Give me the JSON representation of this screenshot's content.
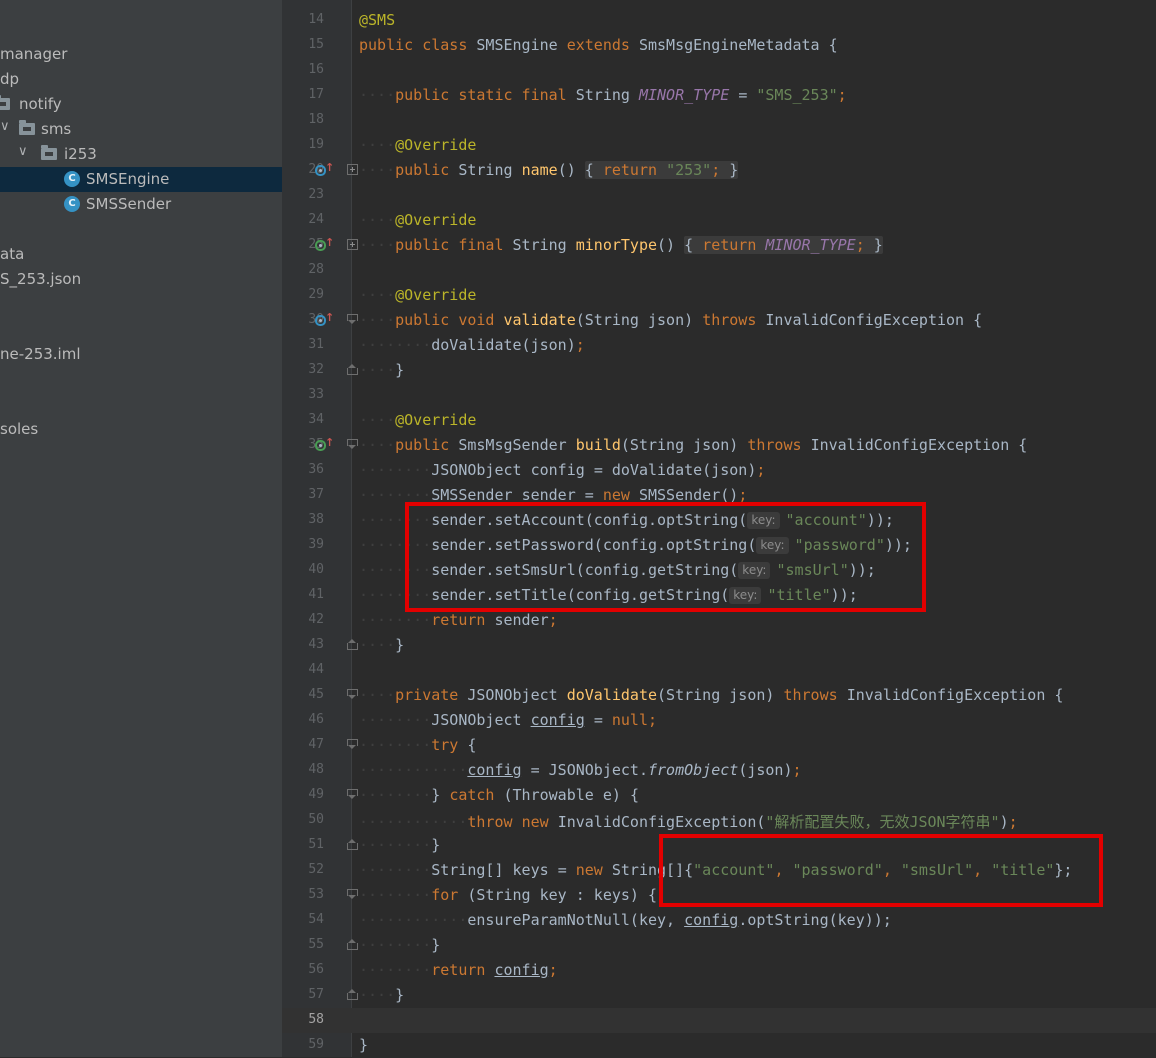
{
  "sidebar": {
    "items": [
      {
        "label": "manager"
      },
      {
        "label": "dp"
      },
      {
        "label": "notify"
      },
      {
        "label": "sms"
      },
      {
        "label": "i253"
      },
      {
        "label": "SMSEngine"
      },
      {
        "label": "SMSSender"
      },
      {
        "label": "ata"
      },
      {
        "label": "S_253.json"
      },
      {
        "label": "ne-253.iml"
      },
      {
        "label": "soles"
      }
    ],
    "class_icon_glyph": "C"
  },
  "editor": {
    "line_numbers": [
      "14",
      "15",
      "16",
      "17",
      "18",
      "19",
      "20",
      "23",
      "24",
      "25",
      "28",
      "29",
      "30",
      "31",
      "32",
      "33",
      "34",
      "35",
      "36",
      "37",
      "38",
      "39",
      "40",
      "41",
      "42",
      "43",
      "44",
      "45",
      "46",
      "47",
      "48",
      "49",
      "50",
      "51",
      "52",
      "53",
      "54",
      "55",
      "56",
      "57",
      "58",
      "59"
    ],
    "tokens": {
      "annotation_sms": "@SMS",
      "public": "public",
      "class": "class",
      "engine_name": "SMSEngine",
      "extends": "extends",
      "parent_class": "SmsMsgEngineMetadata",
      "open_brace": "{",
      "close_brace": "}",
      "static_final": "static final",
      "final": "final",
      "string_type": "String",
      "minor_type_const": "MINOR_TYPE",
      "assign": "=",
      "sms253_str": "\"SMS_253\"",
      "semicolon": ";",
      "override": "@Override",
      "name_method": "name",
      "paren_pair": "()",
      "return": "return",
      "str_253": "\"253\"",
      "minor_type_method": "minorType",
      "void": "void",
      "validate_method": "validate",
      "validate_params": "(String json)",
      "throws": "throws",
      "exception_class": "InvalidConfigException",
      "do_validate_call": "doValidate(json)",
      "sender_type": "SmsMsgSender",
      "build_method": "build",
      "json_object_type": "JSONObject",
      "config_var": "config",
      "sender_class": "SMSSender",
      "sender_var": "sender",
      "new": "new",
      "set_account": "sender.setAccount(config.optString(",
      "set_password": "sender.setPassword(config.optString(",
      "set_sms_url": "sender.setSmsUrl(config.getString(",
      "set_title": "sender.setTitle(config.getString(",
      "key_hint": "key:",
      "account_str": "\"account\"",
      "password_str": "\"password\"",
      "sms_url_str": "\"smsUrl\"",
      "title_str": "\"title\"",
      "close_call": "));",
      "private": "private",
      "do_validate_method": "doValidate",
      "null": "null",
      "try": "try",
      "from_object_prefix": "JSONObject.",
      "from_object": "fromObject",
      "json_arg": "(json)",
      "catch": "catch",
      "throwable_e": "(Throwable e)",
      "throw": "throw",
      "exception_call": "InvalidConfigException(",
      "chinese_msg": "\"解析配置失败，无效JSON字符串\"",
      "close_paren": ")",
      "string_array": "String[]",
      "keys_var": "keys",
      "string_array_new": "String[]{",
      "comma": ",",
      "close_array": "};",
      "for": "for",
      "for_cond": "(String key : keys)",
      "ensure_call": "ensureParamNotNull(key,",
      "opt_string_key": ".optString(key));",
      "folded_placeholder": "{",
      "folded_end": "}"
    }
  },
  "colors": {
    "keyword": "#cc7832",
    "annotation": "#bbb529",
    "string": "#6a8759",
    "method": "#ffc66d",
    "constant": "#9876aa",
    "highlight_box": "#e30000",
    "selected_tree_row": "#0d293e"
  },
  "icons": {
    "override_marker": "overrides-method-icon",
    "implements_marker": "implements-method-icon",
    "fold_marker": "code-fold-icon"
  }
}
